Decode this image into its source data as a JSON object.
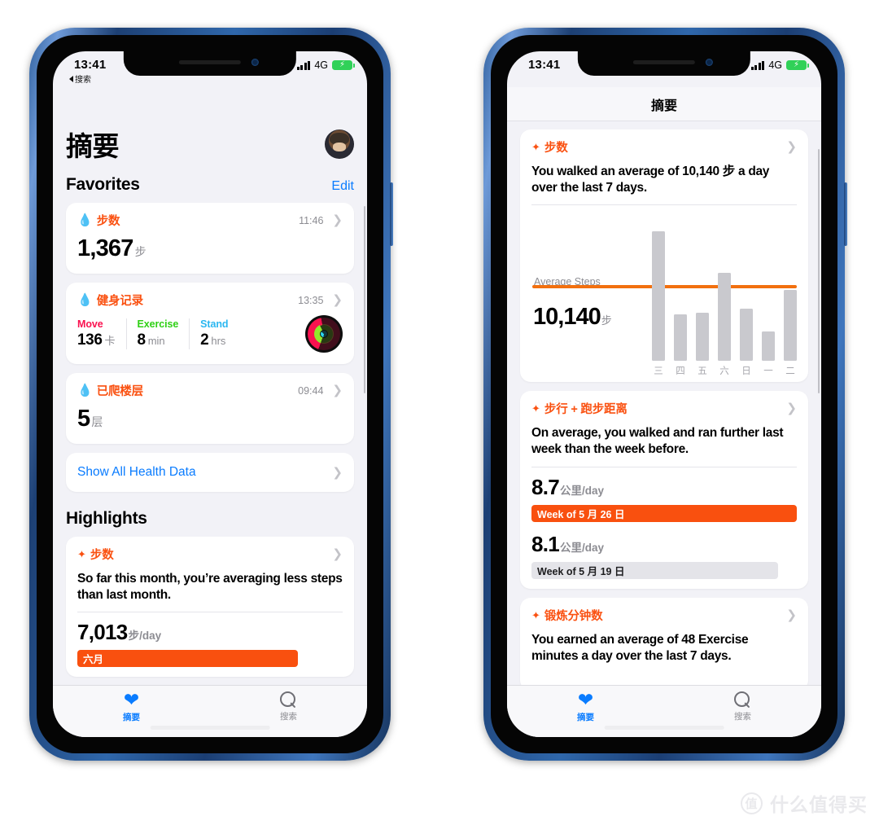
{
  "meta": {
    "accent_orange": "#fa5111",
    "accent_blue": "#0a7cff",
    "bar_gray": "#c9c9ce",
    "avg_line": "#f2700f"
  },
  "watermark": {
    "logo": "值",
    "text": "什么值得买"
  },
  "left_phone": {
    "status": {
      "time": "13:41",
      "back_label": "搜索",
      "network": "4G",
      "battery_icon": "charging-battery",
      "signal_icon": "signal-bars"
    },
    "page_title": "摘要",
    "avatar_name": "user-avatar",
    "favorites": {
      "title": "Favorites",
      "edit_label": "Edit",
      "cards": [
        {
          "icon": "flame-icon",
          "title": "步数",
          "time": "11:46",
          "value": "1,367",
          "unit": "步"
        },
        {
          "icon": "flame-icon",
          "title": "健身记录",
          "time": "13:35",
          "metrics": [
            {
              "label": "Move",
              "color": "#fa114f",
              "value": "136",
              "unit": "卡"
            },
            {
              "label": "Exercise",
              "color": "#2fd015",
              "value": "8",
              "unit": "min"
            },
            {
              "label": "Stand",
              "color": "#2bb7f0",
              "value": "2",
              "unit": "hrs"
            }
          ],
          "rings_name": "activity-rings"
        },
        {
          "icon": "flame-icon",
          "title": "已爬楼层",
          "time": "09:44",
          "value": "5",
          "unit": "层"
        }
      ],
      "show_all_label": "Show All Health Data"
    },
    "highlights": {
      "title": "Highlights",
      "card": {
        "icon": "sparkle-icon",
        "title": "步数",
        "text": "So far this month, you’re averaging less steps than last month.",
        "value": "7,013",
        "unit": "步/day",
        "bar_label": "六月",
        "bar_style": "hot"
      }
    },
    "tabs": [
      {
        "icon": "heart-icon",
        "label": "摘要",
        "active": true
      },
      {
        "icon": "search-icon",
        "label": "搜索",
        "active": false
      }
    ]
  },
  "right_phone": {
    "status": {
      "time": "13:41",
      "network": "4G",
      "battery_icon": "charging-battery",
      "signal_icon": "signal-bars"
    },
    "nav_title": "摘要",
    "cards": [
      {
        "icon": "sparkle-icon",
        "title": "步数",
        "text": "You walked an average of 10,140 步 a day over the last 7 days.",
        "chart_label": "Average Steps",
        "chart_value": "10,140",
        "chart_unit": "步"
      },
      {
        "icon": "sparkle-icon",
        "title": "步行 + 跑步距离",
        "text": "On average, you walked and ran further last week than the week before.",
        "rows": [
          {
            "value": "8.7",
            "unit": "公里/day",
            "bar_label": "Week of 5 月 26 日",
            "bar_style": "hot"
          },
          {
            "value": "8.1",
            "unit": "公里/day",
            "bar_label": "Week of 5 月 19 日",
            "bar_style": "cool"
          }
        ]
      },
      {
        "icon": "sparkle-icon",
        "title": "锻炼分钟数",
        "text": "You earned an average of 48 Exercise minutes a day over the last 7 days."
      }
    ],
    "tabs": [
      {
        "icon": "heart-icon",
        "label": "摘要",
        "active": true
      },
      {
        "icon": "search-icon",
        "label": "搜索",
        "active": false
      }
    ]
  },
  "chart_data": {
    "type": "bar",
    "title": "Average Steps — last 7 days",
    "categories": [
      "三",
      "四",
      "五",
      "六",
      "日",
      "一",
      "二"
    ],
    "values": [
      17800,
      6400,
      6600,
      12100,
      7200,
      4000,
      9700
    ],
    "average": 10140,
    "average_label": "Average Steps",
    "average_display": "10,140",
    "unit": "步",
    "xlabel": "",
    "ylabel": "",
    "ylim": [
      0,
      19000
    ],
    "grid": false,
    "legend": "none",
    "bar_color": "#c9c9ce",
    "average_line_color": "#f2700f"
  }
}
